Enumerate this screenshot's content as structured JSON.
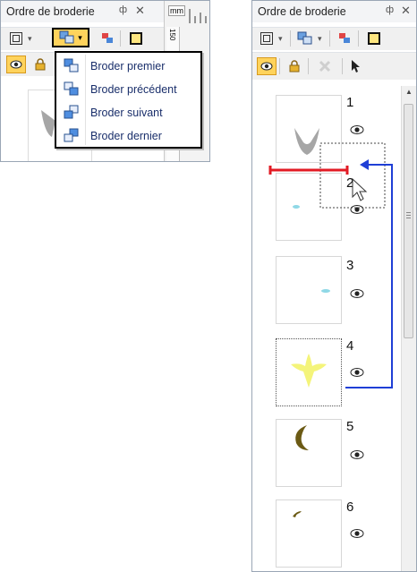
{
  "left_panel": {
    "title": "Ordre de broderie",
    "pin": "ф",
    "close": "✕",
    "ruler_unit": "mm",
    "ruler_digits": "150",
    "menu": {
      "items": [
        {
          "label": "Broder premier"
        },
        {
          "label": "Broder précédent"
        },
        {
          "label": "Broder suivant"
        },
        {
          "label": "Broder dernier"
        }
      ]
    }
  },
  "right_panel": {
    "title": "Ordre de broderie",
    "pin": "ф",
    "close": "✕",
    "items": [
      {
        "number": "1",
        "color": "#a6a6a6",
        "shape": "v-shape"
      },
      {
        "number": "2",
        "color": "#8fd8e6",
        "shape": "small-blob"
      },
      {
        "number": "3",
        "color": "#8fd8e6",
        "shape": "small-blob"
      },
      {
        "number": "4",
        "color": "#f4f47a",
        "shape": "flower"
      },
      {
        "number": "5",
        "color": "#6b5a14",
        "shape": "crescent"
      },
      {
        "number": "6",
        "color": "#6b5a14",
        "shape": "small-arc"
      }
    ]
  },
  "colors": {
    "insert_marker": "#e21b24",
    "drag_arrow": "#1f3fd6",
    "selected_button": "#ffd35c"
  }
}
